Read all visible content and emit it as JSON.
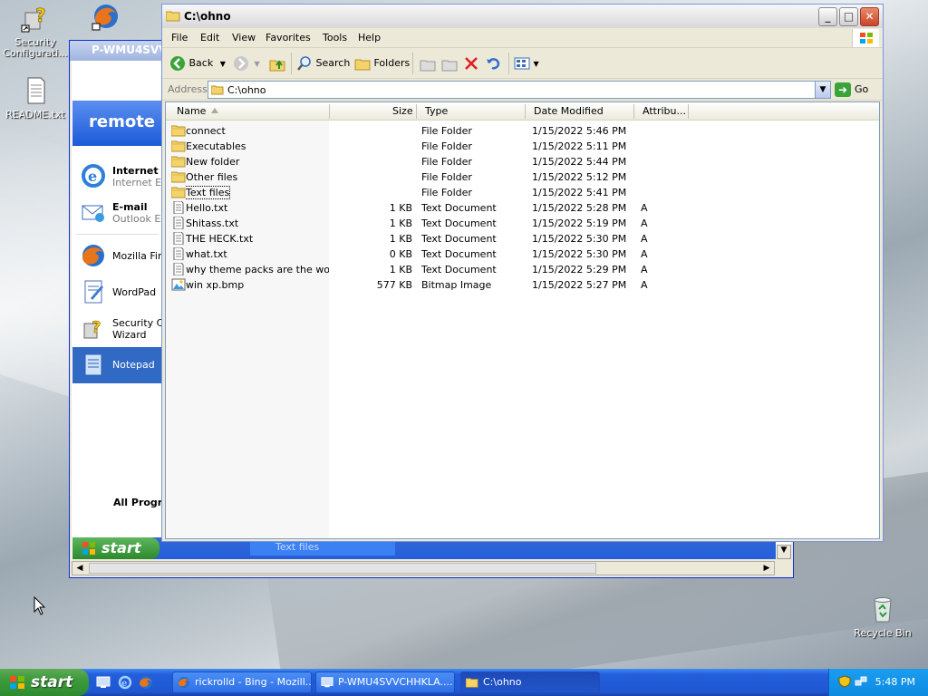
{
  "desktop": {
    "icons": [
      {
        "label": "Security Configurati..."
      },
      {
        "label": "README.txt"
      },
      {
        "label": "Recycle Bin"
      }
    ]
  },
  "remote_window": {
    "title": "P-WMU4SVV",
    "start_menu": {
      "header": "remote",
      "items": [
        {
          "title": "Internet",
          "subtitle": "Internet Ex",
          "icon": "ie-icon"
        },
        {
          "title": "E-mail",
          "subtitle": "Outlook Ex",
          "icon": "outlook-icon"
        },
        {
          "title": "Mozilla Fire",
          "subtitle": "",
          "icon": "firefox-icon"
        },
        {
          "title": "WordPad",
          "subtitle": "",
          "icon": "wordpad-icon"
        },
        {
          "title": "Security Co",
          "subtitle": "Wizard",
          "icon": "security-wizard-icon"
        },
        {
          "title": "Notepad",
          "subtitle": "",
          "icon": "notepad-icon"
        }
      ],
      "all_programs": "All Progra"
    },
    "inner_taskbar": {
      "start_label": "start",
      "task_label": "Text files"
    }
  },
  "explorer": {
    "title": "C:\\ohno",
    "menu": [
      "File",
      "Edit",
      "View",
      "Favorites",
      "Tools",
      "Help"
    ],
    "toolbar": {
      "back": "Back",
      "search": "Search",
      "folders": "Folders"
    },
    "address": {
      "label": "Address",
      "value": "C:\\ohno",
      "go": "Go"
    },
    "columns": [
      "Name",
      "Size",
      "Type",
      "Date Modified",
      "Attribu..."
    ],
    "files": [
      {
        "name": "connect",
        "size": "",
        "type": "File Folder",
        "date": "1/15/2022 5:46 PM",
        "attr": "",
        "kind": "folder"
      },
      {
        "name": "Executables",
        "size": "",
        "type": "File Folder",
        "date": "1/15/2022 5:11 PM",
        "attr": "",
        "kind": "folder"
      },
      {
        "name": "New folder",
        "size": "",
        "type": "File Folder",
        "date": "1/15/2022 5:44 PM",
        "attr": "",
        "kind": "folder"
      },
      {
        "name": "Other files",
        "size": "",
        "type": "File Folder",
        "date": "1/15/2022 5:12 PM",
        "attr": "",
        "kind": "folder"
      },
      {
        "name": "Text files",
        "size": "",
        "type": "File Folder",
        "date": "1/15/2022 5:41 PM",
        "attr": "",
        "kind": "folder"
      },
      {
        "name": "Hello.txt",
        "size": "1 KB",
        "type": "Text Document",
        "date": "1/15/2022 5:28 PM",
        "attr": "A",
        "kind": "text"
      },
      {
        "name": "Shitass.txt",
        "size": "1 KB",
        "type": "Text Document",
        "date": "1/15/2022 5:19 PM",
        "attr": "A",
        "kind": "text"
      },
      {
        "name": "THE HECK.txt",
        "size": "1 KB",
        "type": "Text Document",
        "date": "1/15/2022 5:30 PM",
        "attr": "A",
        "kind": "text"
      },
      {
        "name": "what.txt",
        "size": "0 KB",
        "type": "Text Document",
        "date": "1/15/2022 5:30 PM",
        "attr": "A",
        "kind": "text"
      },
      {
        "name": "why theme packs are the wor...",
        "size": "1 KB",
        "type": "Text Document",
        "date": "1/15/2022 5:29 PM",
        "attr": "A",
        "kind": "text"
      },
      {
        "name": "win xp.bmp",
        "size": "577 KB",
        "type": "Bitmap Image",
        "date": "1/15/2022 5:27 PM",
        "attr": "A",
        "kind": "bitmap"
      }
    ]
  },
  "taskbar": {
    "start_label": "start",
    "tasks": [
      {
        "label": "rickrolld - Bing - Mozill...",
        "icon": "firefox-icon"
      },
      {
        "label": "P-WMU4SVVCHHKLA....",
        "icon": "remote-desktop-icon"
      },
      {
        "label": "C:\\ohno",
        "icon": "folder-icon",
        "active": true
      }
    ],
    "clock": "5:48 PM"
  },
  "colors": {
    "xp_blue": "#245edb",
    "start_green": "#3c9a3c",
    "folder_yellow": "#f3d46b",
    "selection_blue": "#316ac5"
  }
}
